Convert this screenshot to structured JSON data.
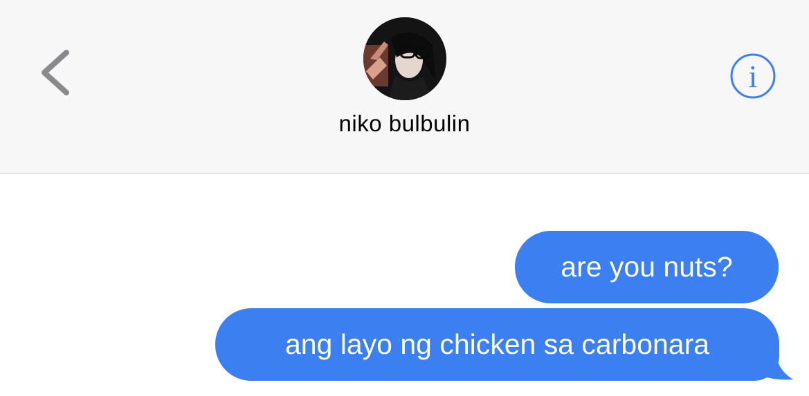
{
  "header": {
    "contact_name": "niko bulbulin",
    "back_icon": "chevron-left-icon",
    "info_icon": "info-circle-icon",
    "accent_color": "#3b7ff1"
  },
  "messages": [
    {
      "text": "are you nuts?",
      "direction": "outgoing"
    },
    {
      "text": "ang layo ng chicken sa carbonara",
      "direction": "outgoing"
    }
  ]
}
